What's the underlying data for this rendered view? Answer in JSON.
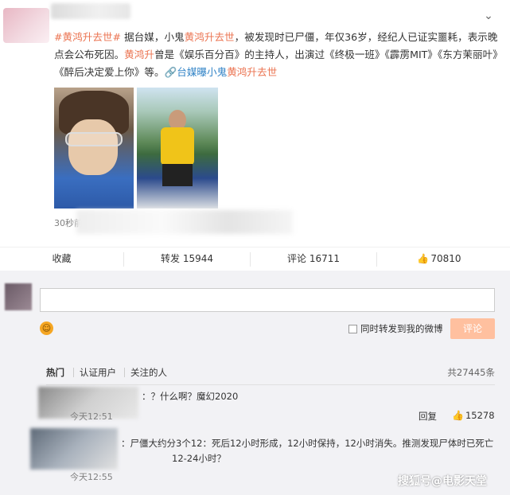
{
  "post": {
    "collapse_icon": "chevron-down-icon",
    "text_parts": {
      "tag": "#黄鸿升去世#",
      "p1": " 据台媒，小鬼",
      "name1": "黄鸿升去世",
      "p2": "，被发现时已尸僵，年仅36岁，经纪人已证实噩耗，表示晚点会公布死因。",
      "name2": "黄鸿升",
      "p3": "曾是《娱乐百分百》的主持人，出演过《终极一班》《霹雳MIT》《东方茉丽叶》《醉后决定爱上你》等。",
      "link_prefix": "台媒曝小鬼",
      "link_name": "黄鸿升去世"
    },
    "time": "30秒前",
    "accent_color": "#eb7350",
    "link_color": "#2f82c6"
  },
  "actions": {
    "collect": "收藏",
    "repost_label": "转发",
    "repost_count": "15944",
    "comment_label": "评论",
    "comment_count": "16711",
    "like_count": "70810"
  },
  "composer": {
    "emoji_icon": "smiley-icon",
    "repost_check_label": "同时转发到我的微博",
    "submit_label": "评论"
  },
  "filters": {
    "hot": "热门",
    "verified": "认证用户",
    "following": "关注的人",
    "total": "共27445条"
  },
  "comments": [
    {
      "text": "：？什么啊？魔幻2020",
      "time": "今天12:51",
      "reply": "回复",
      "likes": "15278"
    },
    {
      "text": "：尸僵大约分3个12：死后12小时形成，12小时保持，12小时消失。推测发现尸体时已死亡12-24小时？",
      "time": "今天12:55"
    }
  ],
  "watermark": "搜狐号@电影天堂"
}
